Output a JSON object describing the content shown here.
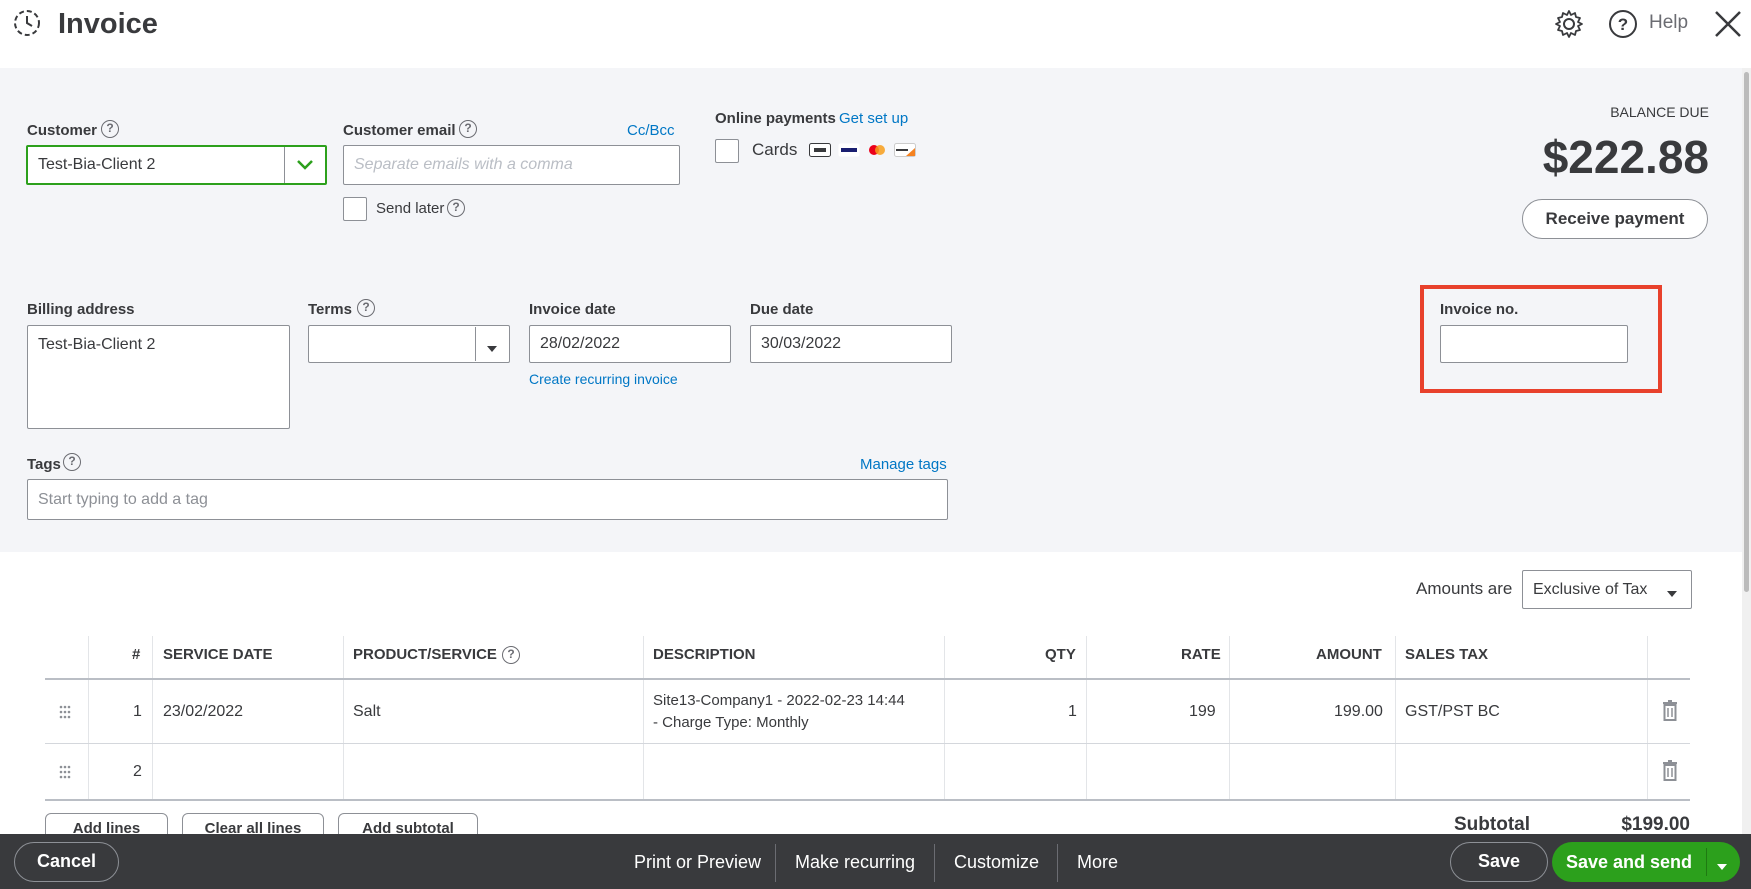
{
  "header": {
    "title": "Invoice",
    "help_label": "Help"
  },
  "customer": {
    "label": "Customer",
    "value": "Test-Bia-Client 2"
  },
  "customer_email": {
    "label": "Customer email",
    "placeholder": "Separate emails with a comma",
    "cc_bcc": "Cc/Bcc",
    "send_later": "Send later"
  },
  "online_payments": {
    "label": "Online payments",
    "setup_link": "Get set up",
    "cards_label": "Cards"
  },
  "balance": {
    "label": "BALANCE DUE",
    "amount": "$222.88",
    "receive_payment": "Receive payment"
  },
  "billing": {
    "label": "Billing address",
    "value": "Test-Bia-Client 2"
  },
  "terms": {
    "label": "Terms",
    "value": ""
  },
  "invoice_date": {
    "label": "Invoice date",
    "value": "28/02/2022",
    "recurring_link": "Create recurring invoice"
  },
  "due_date": {
    "label": "Due date",
    "value": "30/03/2022"
  },
  "invoice_no": {
    "label": "Invoice no.",
    "value": "",
    "highlight_color": "#e8412c"
  },
  "tags": {
    "label": "Tags",
    "manage_link": "Manage tags",
    "placeholder": "Start typing to add a tag"
  },
  "amounts": {
    "label": "Amounts are",
    "value": "Exclusive of Tax"
  },
  "table": {
    "headers": {
      "num": "#",
      "service_date": "SERVICE DATE",
      "product": "PRODUCT/SERVICE",
      "description": "DESCRIPTION",
      "qty": "QTY",
      "rate": "RATE",
      "amount": "AMOUNT",
      "sales_tax": "SALES TAX"
    },
    "rows": [
      {
        "num": "1",
        "service_date": "23/02/2022",
        "product": "Salt",
        "description_line1": "Site13-Company1 - 2022-02-23 14:44",
        "description_line2": "- Charge Type: Monthly",
        "qty": "1",
        "rate": "199",
        "amount": "199.00",
        "sales_tax": "GST/PST BC"
      },
      {
        "num": "2"
      }
    ]
  },
  "table_actions": {
    "add_lines": "Add lines",
    "clear_all": "Clear all lines",
    "add_subtotal": "Add subtotal"
  },
  "totals": {
    "subtotal_label": "Subtotal",
    "subtotal_value": "$199.00"
  },
  "footer": {
    "cancel": "Cancel",
    "print_preview": "Print or Preview",
    "make_recurring": "Make recurring",
    "customize": "Customize",
    "more": "More",
    "save": "Save",
    "save_and_send": "Save and send"
  },
  "colors": {
    "accent_green": "#2ca01c",
    "link_blue": "#0077c5",
    "footer_bg": "#393a3d",
    "form_bg": "#f4f5f8"
  }
}
